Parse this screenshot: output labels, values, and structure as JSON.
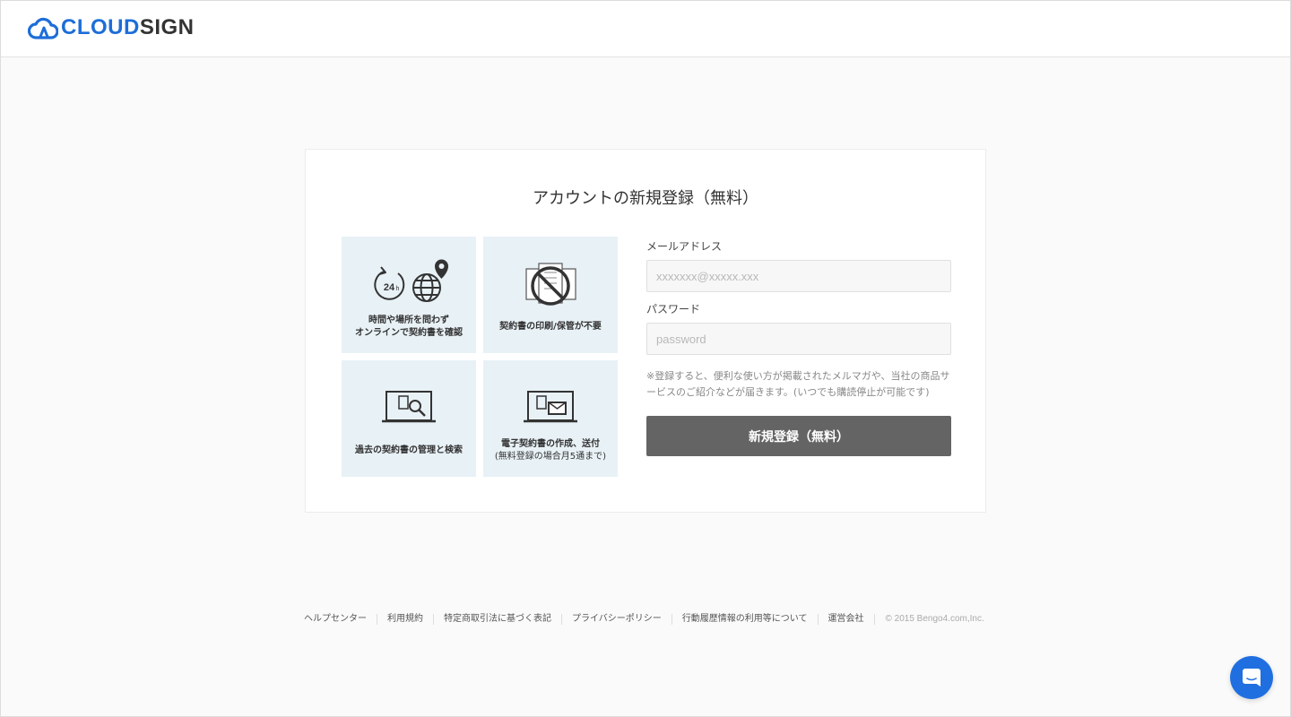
{
  "header": {
    "logo_cloud": "CLOUD",
    "logo_sign": "SIGN"
  },
  "card": {
    "title": "アカウントの新規登録（無料）",
    "features": [
      {
        "icon": "clock-globe-icon",
        "line1": "時間や場所を問わず",
        "line2": "オンラインで契約書を確認"
      },
      {
        "icon": "no-paper-icon",
        "line1": "契約書の印刷/保管が不要"
      },
      {
        "icon": "search-document-icon",
        "line1": "過去の契約書の管理と検索"
      },
      {
        "icon": "send-document-icon",
        "line1": "電子契約書の作成、送付",
        "line2": "(無料登録の場合月5通まで)"
      }
    ]
  },
  "form": {
    "email_label": "メールアドレス",
    "email_placeholder": "xxxxxxx@xxxxx.xxx",
    "email_value": "",
    "password_label": "パスワード",
    "password_placeholder": "password",
    "password_value": "",
    "note_line1": "※登録すると、便利な使い方が掲載されたメルマガや、当社の商品サ",
    "note_line2": "ービスのご紹介などが届きます。(いつでも購読停止が可能です)",
    "submit_label": "新規登録（無料）"
  },
  "footer": {
    "links": [
      "ヘルプセンター",
      "利用規約",
      "特定商取引法に基づく表記",
      "プライバシーポリシー",
      "行動履歴情報の利用等について",
      "運営会社"
    ],
    "copyright": "© 2015 Bengo4.com,Inc."
  },
  "chat": {
    "icon": "chat-icon"
  },
  "colors": {
    "brand_blue": "#1d6ed8",
    "tile_bg": "#e8f1f6",
    "button_bg": "#646464",
    "page_bg": "#fafafa"
  }
}
